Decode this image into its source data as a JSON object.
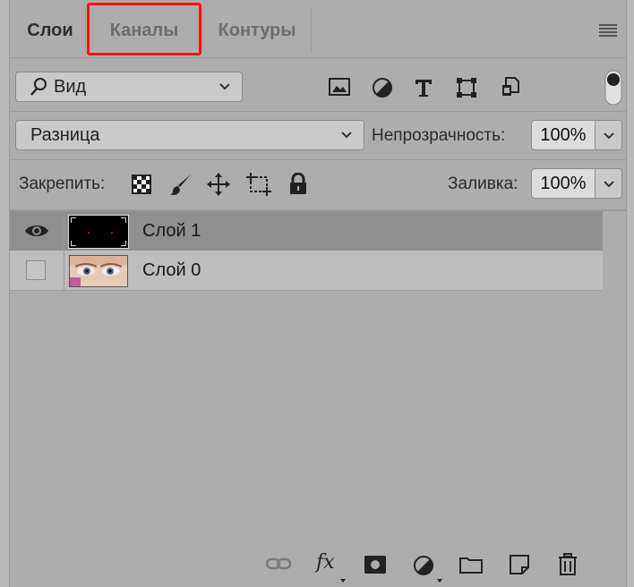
{
  "tabs": [
    {
      "label": "Слои",
      "active": true
    },
    {
      "label": "Каналы",
      "active": false,
      "highlighted": true
    },
    {
      "label": "Контуры",
      "active": false
    }
  ],
  "filter": {
    "kind_label": "Вид",
    "icons": [
      "image-filter-icon",
      "adjustment-filter-icon",
      "type-filter-icon",
      "shape-filter-icon",
      "smart-object-filter-icon"
    ]
  },
  "blend": {
    "mode": "Разница",
    "opacity_label": "Непрозрачность:",
    "opacity_value": "100%"
  },
  "lock": {
    "label": "Закрепить:",
    "icons": [
      "lock-transparency-icon",
      "lock-pixels-icon",
      "lock-position-icon",
      "lock-artboard-icon",
      "lock-all-icon"
    ],
    "fill_label": "Заливка:",
    "fill_value": "100%"
  },
  "layers": [
    {
      "name": "Слой 1",
      "visible": true,
      "selected": true
    },
    {
      "name": "Слой 0",
      "visible": false,
      "selected": false
    }
  ],
  "colors": {
    "tab_highlight": "#ff1111",
    "selected_row": "#8f8f8f",
    "panel_bg": "#adadad"
  },
  "bottom_icons": [
    "link-layers-icon",
    "fx-icon",
    "add-mask-icon",
    "new-adjustment-icon",
    "new-group-icon",
    "new-layer-icon",
    "delete-icon"
  ],
  "fx_label": "fx"
}
